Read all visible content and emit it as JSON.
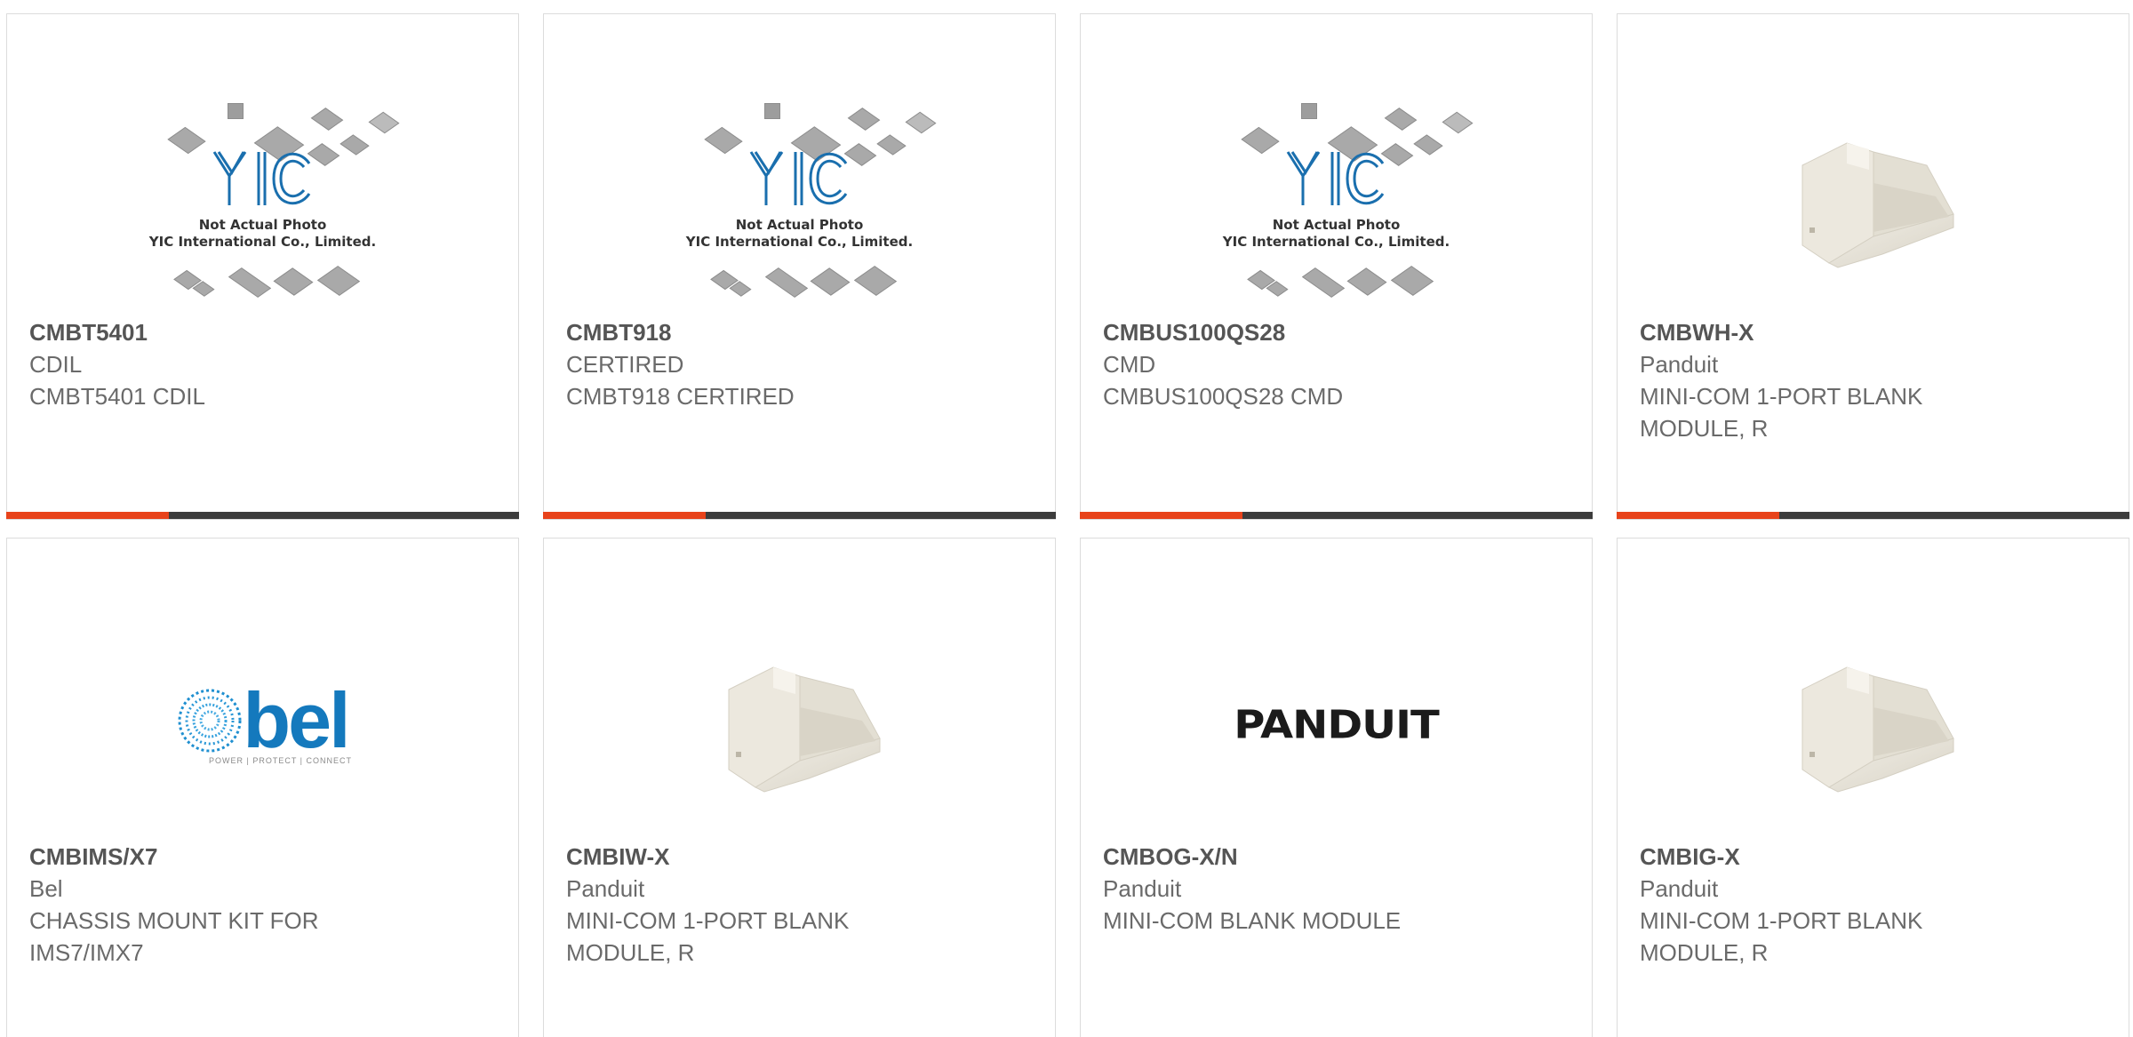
{
  "accent_color": "#e8431b",
  "products": [
    {
      "part": "CMBT5401",
      "manufacturer": "CDIL",
      "description": "CMBT5401 CDIL",
      "image": "yic-placeholder"
    },
    {
      "part": "CMBT918",
      "manufacturer": "CERTIRED",
      "description": "CMBT918 CERTIRED",
      "image": "yic-placeholder"
    },
    {
      "part": "CMBUS100QS28",
      "manufacturer": "CMD",
      "description": "CMBUS100QS28 CMD",
      "image": "yic-placeholder"
    },
    {
      "part": "CMBWH-X",
      "manufacturer": "Panduit",
      "description": "MINI-COM 1-PORT BLANK MODULE, R",
      "image": "blank-module"
    },
    {
      "part": "CMBIMS/X7",
      "manufacturer": "Bel",
      "description": "CHASSIS MOUNT KIT FOR IMS7/IMX7",
      "image": "bel-logo"
    },
    {
      "part": "CMBIW-X",
      "manufacturer": "Panduit",
      "description": "MINI-COM 1-PORT BLANK MODULE, R",
      "image": "blank-module"
    },
    {
      "part": "CMBOG-X/N",
      "manufacturer": "Panduit",
      "description": "MINI-COM BLANK MODULE",
      "image": "panduit-logo"
    },
    {
      "part": "CMBIG-X",
      "manufacturer": "Panduit",
      "description": "MINI-COM 1-PORT BLANK MODULE, R",
      "image": "blank-module"
    }
  ],
  "placeholder": {
    "line1": "Not Actual Photo",
    "line2": "YIC International Co., Limited."
  },
  "logos": {
    "panduit": "PANDUIT",
    "bel": "bel",
    "bel_tagline": "POWER | PROTECT | CONNECT"
  }
}
